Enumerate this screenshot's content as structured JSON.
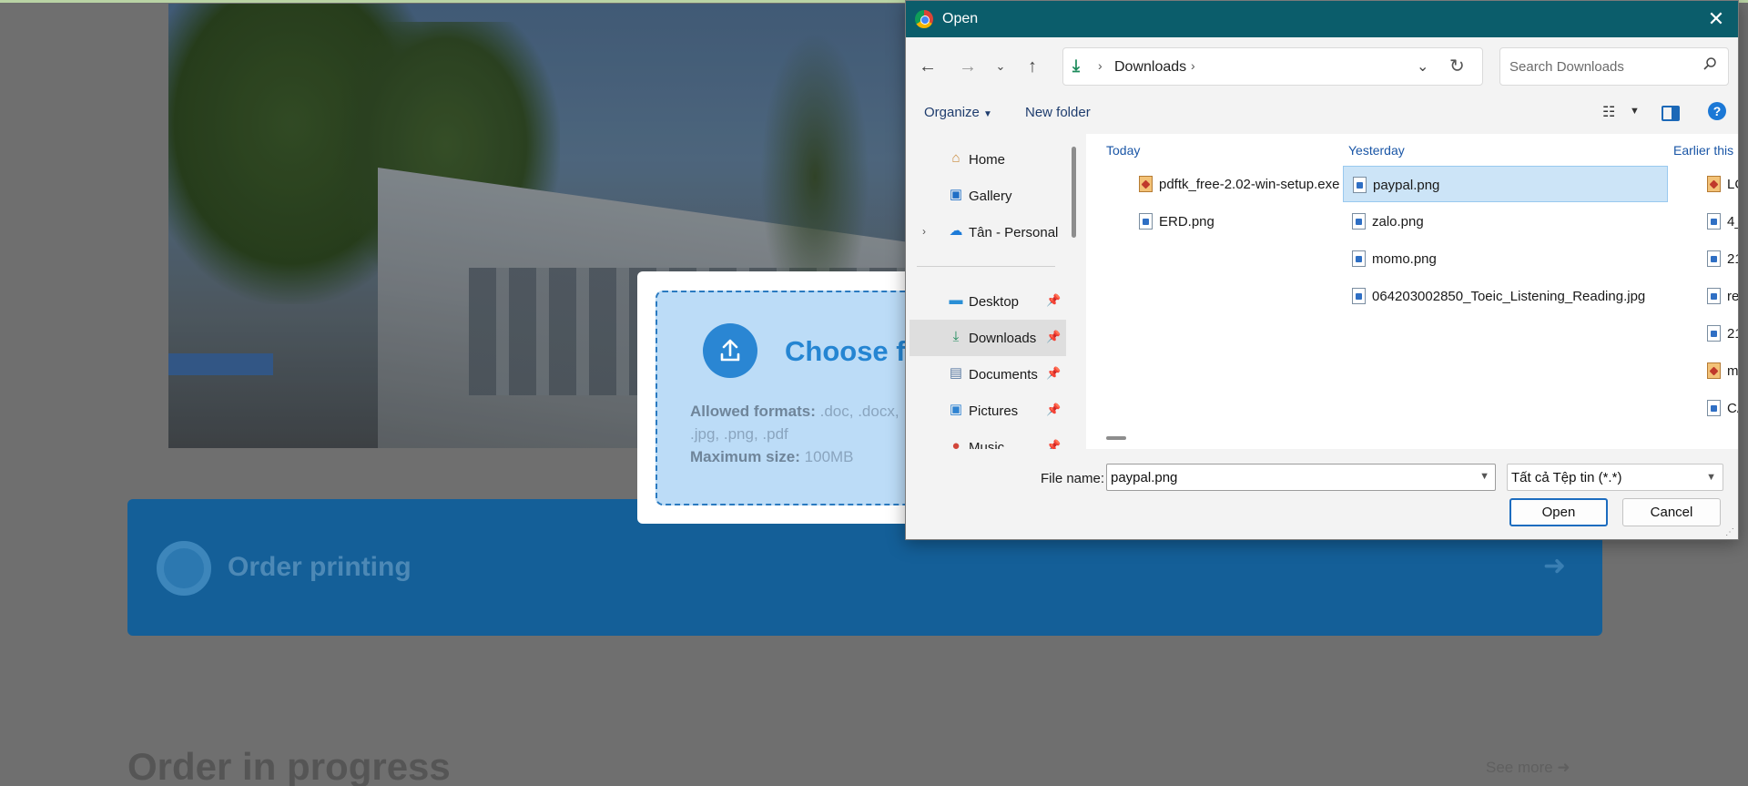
{
  "background_page": {
    "order_printing_label": "Order printing",
    "order_in_progress_title": "Order in progress",
    "see_more": "See more ➜"
  },
  "upload_modal": {
    "choose_text": "Choose f",
    "allowed_formats_label": "Allowed formats:",
    "allowed_formats_value": " .doc, .docx,",
    "allowed_formats_value_line2": ".jpg, .png, .pdf",
    "max_size_label": "Maximum size:",
    "max_size_value": " 100MB"
  },
  "dialog": {
    "title": "Open",
    "address": {
      "location": "Downloads"
    },
    "search_placeholder": "Search Downloads",
    "toolbar": {
      "organize_label": "Organize",
      "new_folder_label": "New folder"
    },
    "nav_items": [
      {
        "label": "Home"
      },
      {
        "label": "Gallery"
      },
      {
        "label": "Tân - Personal"
      },
      {
        "label": "Desktop"
      },
      {
        "label": "Downloads"
      },
      {
        "label": "Documents"
      },
      {
        "label": "Pictures"
      },
      {
        "label": "Music"
      }
    ],
    "groups": {
      "today": "Today",
      "yesterday": "Yesterday",
      "earlier": "Earlier this"
    },
    "files_today": [
      {
        "name": "pdftk_free-2.02-win-setup.exe"
      },
      {
        "name": "ERD.png"
      }
    ],
    "files_yesterday": [
      {
        "name": "paypal.png"
      },
      {
        "name": "zalo.png"
      },
      {
        "name": "momo.png"
      },
      {
        "name": "064203002850_Toeic_Listening_Reading.jpg"
      }
    ],
    "files_earlier_partial": [
      "LC",
      "4_",
      "21",
      "re",
      "21",
      "m",
      "CA"
    ],
    "file_name_label": "File name:",
    "file_name_value": "paypal.png",
    "file_type_value": "Tất cả Tệp tin (*.*)",
    "open_button": "Open",
    "cancel_button": "Cancel"
  },
  "colors": {
    "titlebar": "#0b5d6b",
    "selection": "#cce4f7",
    "accent": "#1c6cbf",
    "modal_blue": "#2585d2"
  }
}
